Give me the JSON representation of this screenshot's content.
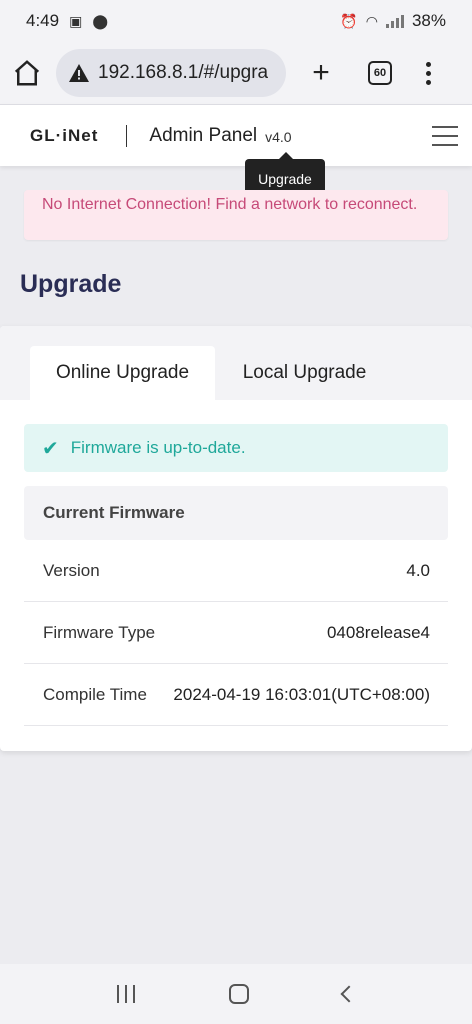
{
  "status_bar": {
    "time": "4:49",
    "battery": "38%"
  },
  "browser": {
    "url": "192.168.8.1/#/upgra",
    "tab_count": "60"
  },
  "header": {
    "brand": "GL·iNet",
    "title": "Admin Panel",
    "version": "v4.0"
  },
  "tooltip": {
    "text": "Upgrade"
  },
  "alert": {
    "text": "No Internet Connection! Find a network to reconnect."
  },
  "page": {
    "title": "Upgrade"
  },
  "tabs": [
    {
      "label": "Online Upgrade",
      "active": true
    },
    {
      "label": "Local Upgrade",
      "active": false
    }
  ],
  "status": {
    "message": "Firmware is up-to-date."
  },
  "firmware": {
    "header": "Current Firmware",
    "rows": [
      {
        "label": "Version",
        "value": "4.0"
      },
      {
        "label": "Firmware Type",
        "value": "0408release4"
      },
      {
        "label": "Compile Time",
        "value": "2024-04-19 16:03:01(UTC+08:00)"
      }
    ]
  },
  "colors": {
    "accent": "#1fa89a",
    "alert_text": "#c64a78",
    "title": "#2a2d55"
  }
}
